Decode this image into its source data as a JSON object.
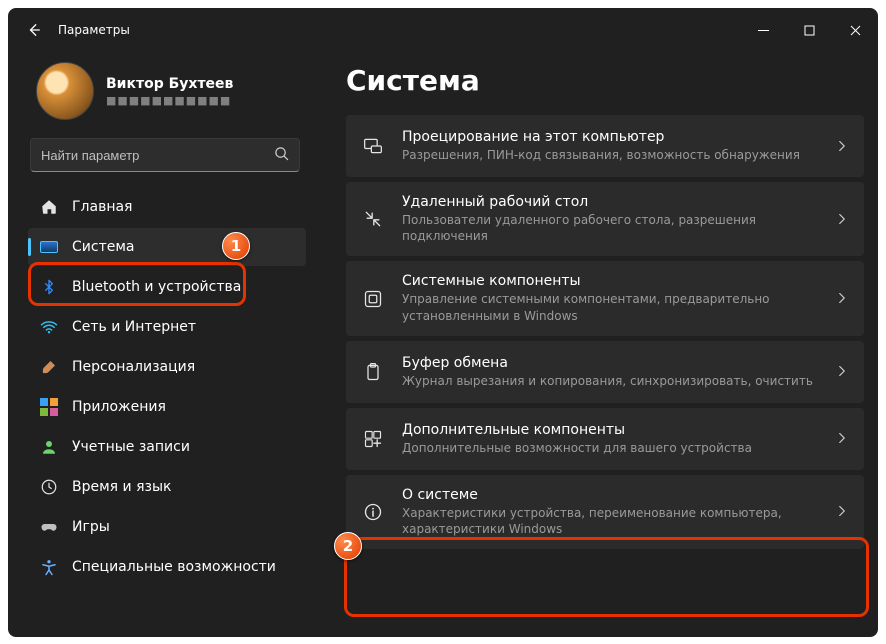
{
  "window": {
    "title": "Параметры"
  },
  "user": {
    "name": "Виктор Бухтеев",
    "sub": "■■■■■■■■■■■"
  },
  "search": {
    "placeholder": "Найти параметр"
  },
  "nav": [
    {
      "key": "home",
      "label": "Главная"
    },
    {
      "key": "system",
      "label": "Система"
    },
    {
      "key": "bt",
      "label": "Bluetooth и устройства"
    },
    {
      "key": "net",
      "label": "Сеть и Интернет"
    },
    {
      "key": "pers",
      "label": "Персонализация"
    },
    {
      "key": "apps",
      "label": "Приложения"
    },
    {
      "key": "acct",
      "label": "Учетные записи"
    },
    {
      "key": "time",
      "label": "Время и язык"
    },
    {
      "key": "game",
      "label": "Игры"
    },
    {
      "key": "access",
      "label": "Специальные возможности"
    }
  ],
  "page": {
    "title": "Система"
  },
  "cards": [
    {
      "key": "project",
      "title": "Проецирование на этот компьютер",
      "desc": "Разрешения, ПИН-код связывания, возможность обнаружения"
    },
    {
      "key": "rdp",
      "title": "Удаленный рабочий стол",
      "desc": "Пользователи удаленного рабочего стола, разрешения подключения"
    },
    {
      "key": "syscomp",
      "title": "Системные компоненты",
      "desc": "Управление системными компонентами, предварительно установленными в Windows"
    },
    {
      "key": "clip",
      "title": "Буфер обмена",
      "desc": "Журнал вырезания и копирования, синхронизировать, очистить"
    },
    {
      "key": "optional",
      "title": "Дополнительные компоненты",
      "desc": "Дополнительные возможности для вашего устройства"
    },
    {
      "key": "about",
      "title": "О системе",
      "desc": "Характеристики устройства, переименование компьютера, характеристики Windows"
    }
  ],
  "anno": {
    "b1": "1",
    "b2": "2"
  }
}
